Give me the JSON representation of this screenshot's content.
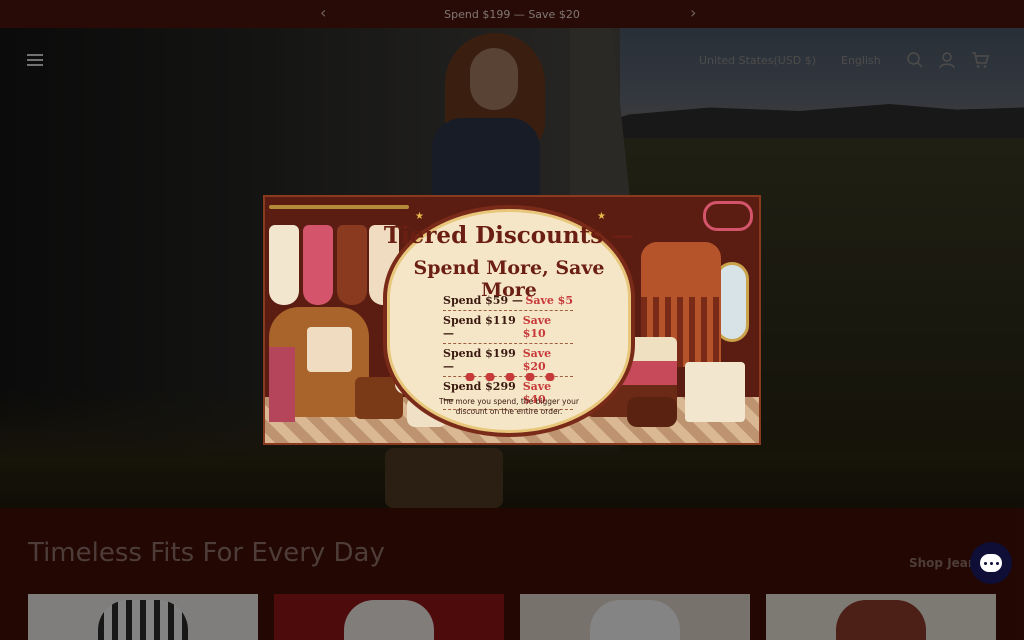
{
  "announcement": {
    "text": "Spend $199 — Save $20",
    "prev_icon": "chevron-left-icon",
    "next_icon": "chevron-right-icon"
  },
  "header": {
    "locale": "United States(USD $)",
    "language": "English",
    "icons": [
      "menu-icon",
      "search-icon",
      "account-icon",
      "cart-icon"
    ]
  },
  "modal": {
    "title": "Tiered Discounts —",
    "subtitle": "Spend More, Save More",
    "tiers": [
      {
        "spend": "Spend $59 —",
        "save": "Save $5"
      },
      {
        "spend": "Spend $119 —",
        "save": "Save $10"
      },
      {
        "spend": "Spend $199 —",
        "save": "Save $20"
      },
      {
        "spend": "Spend $299 —",
        "save": "Save $40"
      }
    ],
    "note": "The more you spend, the bigger your discount on the entire order."
  },
  "section": {
    "title": "Timeless Fits For Every Day",
    "shop_link": "Shop Jean"
  },
  "colors": {
    "page_bg": "#3a0d07",
    "announce_bg": "#4a130c",
    "chat_bg": "#0e0e36",
    "save_red": "#c73a3a"
  }
}
